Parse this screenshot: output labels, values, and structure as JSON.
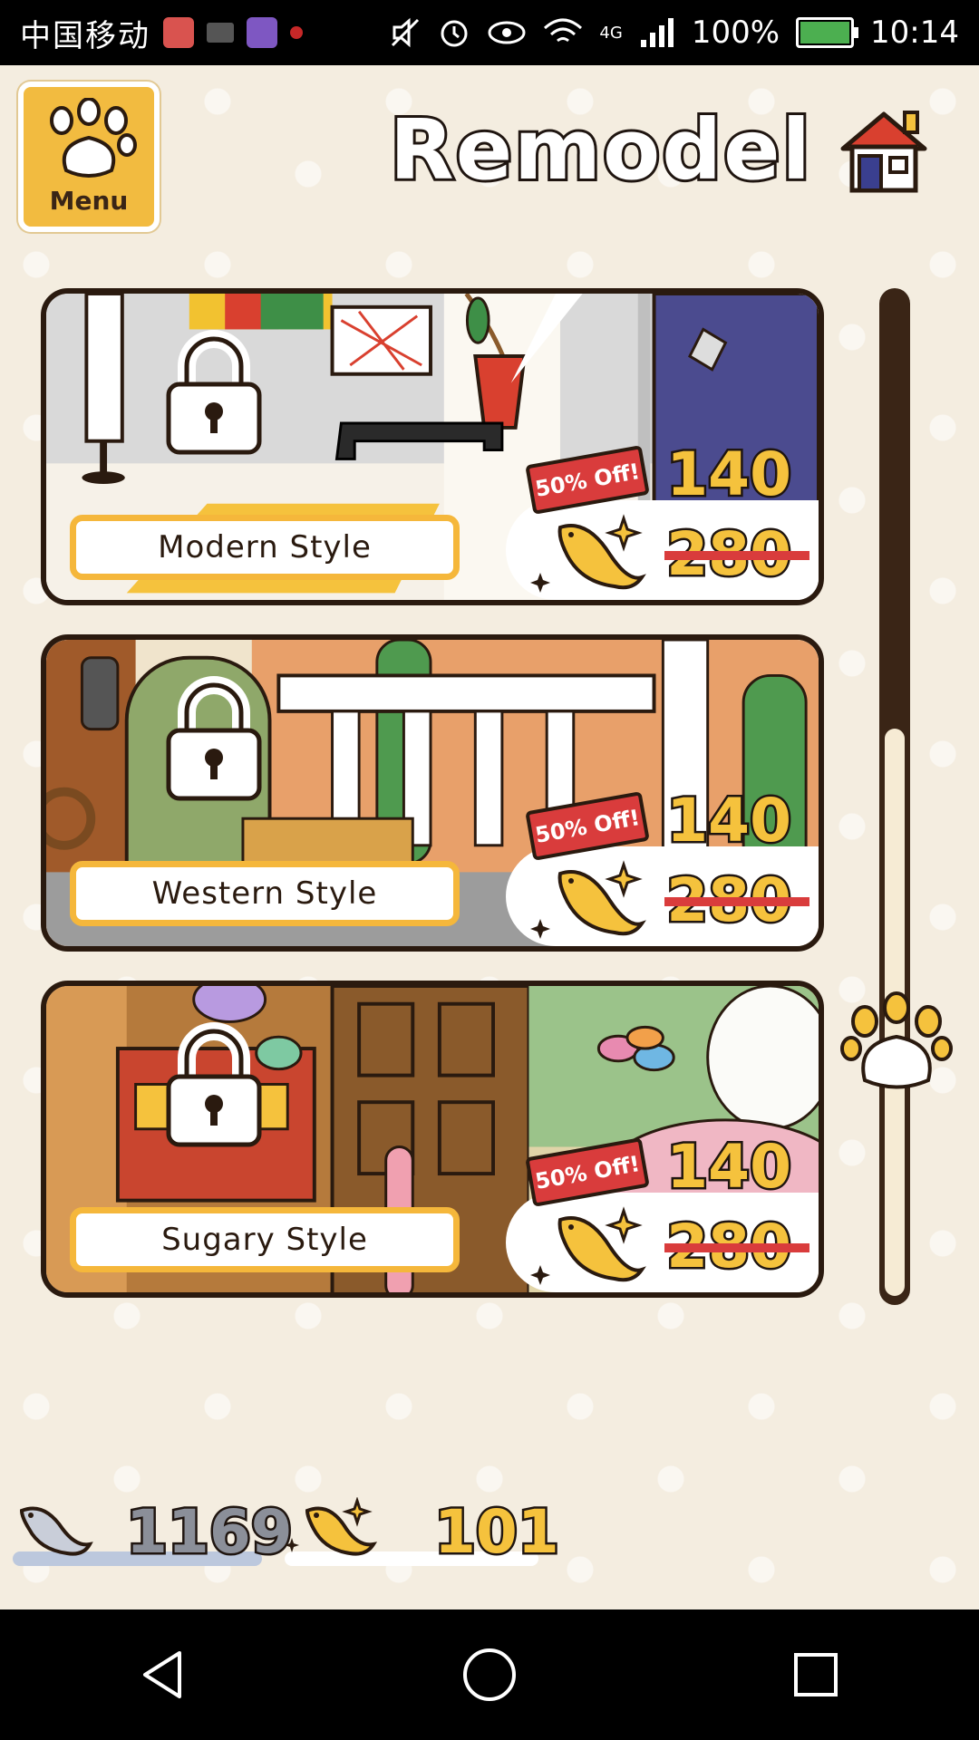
{
  "statusbar": {
    "carrier": "中国移动",
    "network": "4G",
    "battery": "100%",
    "time": "10:14"
  },
  "header": {
    "menu_label": "Menu",
    "title": "Remodel"
  },
  "cards": [
    {
      "name": "Modern Style",
      "sale": "50% Off!",
      "price_new": "140",
      "price_old": "280"
    },
    {
      "name": "Western Style",
      "sale": "50% Off!",
      "price_new": "140",
      "price_old": "280"
    },
    {
      "name": "Sugary Style",
      "sale": "50% Off!",
      "price_new": "140",
      "price_old": "280"
    }
  ],
  "scroll": {
    "position": 0.72
  },
  "resources": {
    "silver_fish": "1169",
    "gold_fish": "101"
  },
  "colors": {
    "accent_yellow": "#f5c23d",
    "menu_orange": "#f2bb40",
    "outline_brown": "#2a1a0f",
    "sale_red": "#d93c3c",
    "background": "#f4ede0"
  },
  "icons": {
    "menu": "paw-icon",
    "home": "house-icon",
    "lock": "lock-icon",
    "gold_fish": "gold-fish-icon",
    "silver_fish": "silver-fish-icon",
    "scroll_thumb": "paw-icon",
    "nav_back": "triangle-back-icon",
    "nav_home": "circle-home-icon",
    "nav_recent": "square-recent-icon"
  }
}
